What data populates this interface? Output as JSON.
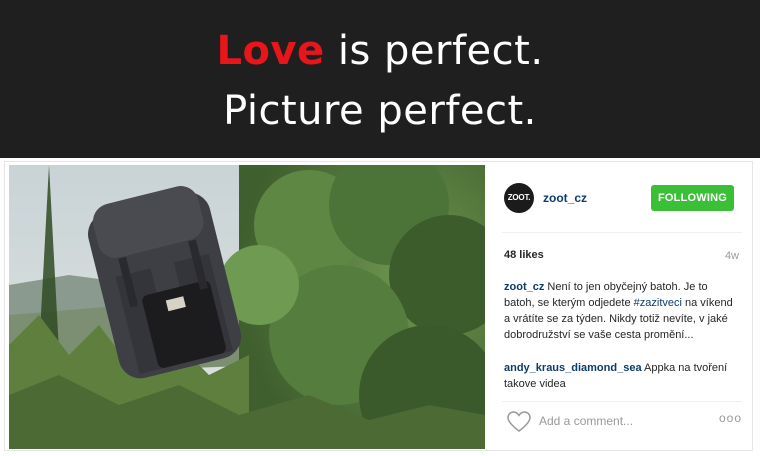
{
  "banner": {
    "love_word": "Love",
    "line1_rest": " is perfect.",
    "line2": "Picture perfect.",
    "accent_color": "#e8151b"
  },
  "post": {
    "avatar_text": "ZOOT.",
    "username": "zoot_cz",
    "follow_label": "FOLLOWING",
    "follow_color": "#3bbf36",
    "likes": "48 likes",
    "age": "4w",
    "caption": {
      "user": "zoot_cz",
      "text_before_tag": " Není to jen obyčejný batoh. Je to batoh, se kterým odjedete ",
      "hashtag": "#zazitveci",
      "text_after_tag": " na víkend a vrátíte se za týden. Nikdy totiž nevíte, v jaké dobrodružství se vaše cesta promění..."
    },
    "comments": [
      {
        "user": "andy_kraus_diamond_sea",
        "text": " Appka na tvoření takove videa"
      }
    ],
    "comment_placeholder": "Add a comment...",
    "more_label": "ooo",
    "icons": [
      "heart-icon",
      "more-options-icon"
    ]
  }
}
